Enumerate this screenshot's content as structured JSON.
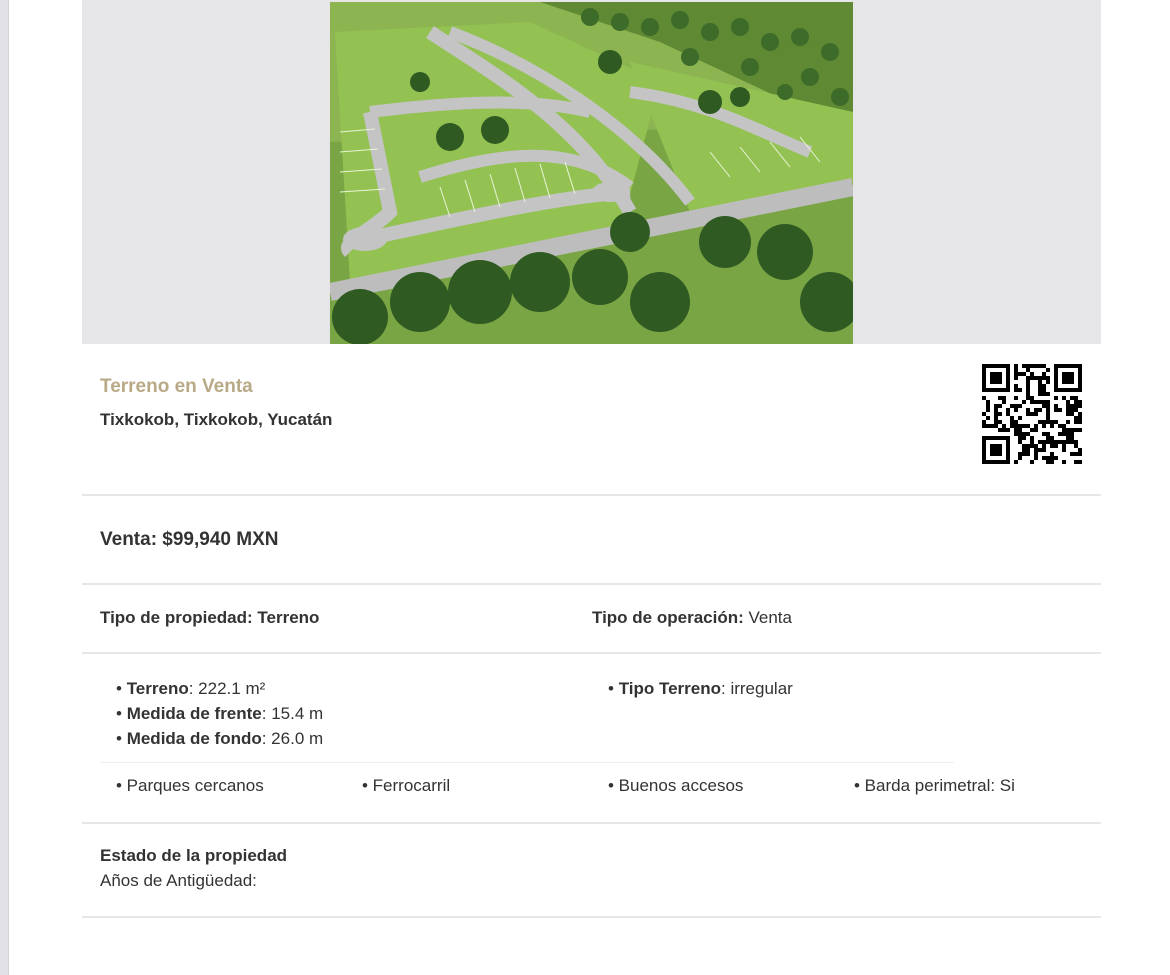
{
  "property": {
    "title": "Terreno en Venta",
    "location": "Tixkokob, Tixkokob, Yucatán"
  },
  "price": {
    "text": "Venta: $99,940 MXN"
  },
  "type": {
    "property_type": "Tipo de propiedad: Terreno",
    "operation_label": "Tipo de operación:",
    "operation_value": "Venta"
  },
  "features": {
    "left": [
      {
        "label": "Terreno",
        "value": ": 222.1 m²"
      },
      {
        "label": "Medida de frente",
        "value": ": 15.4 m"
      },
      {
        "label": "Medida de fondo",
        "value": ": 26.0 m"
      }
    ],
    "right": [
      {
        "label": "Tipo Terreno",
        "value": ": irregular"
      }
    ],
    "amenities": [
      "• Parques cercanos",
      "• Ferrocarril",
      "• Buenos accesos",
      "• Barda perimetral: Si"
    ]
  },
  "state": {
    "title": "Estado de la propiedad",
    "age_label": "Años de Antigüedad:"
  },
  "bullet": "• ",
  "colors": {
    "title_accent": "#b9aa87",
    "text": "#333333",
    "divider": "#e7e7e7",
    "photo_band": "#e6e6e8"
  }
}
